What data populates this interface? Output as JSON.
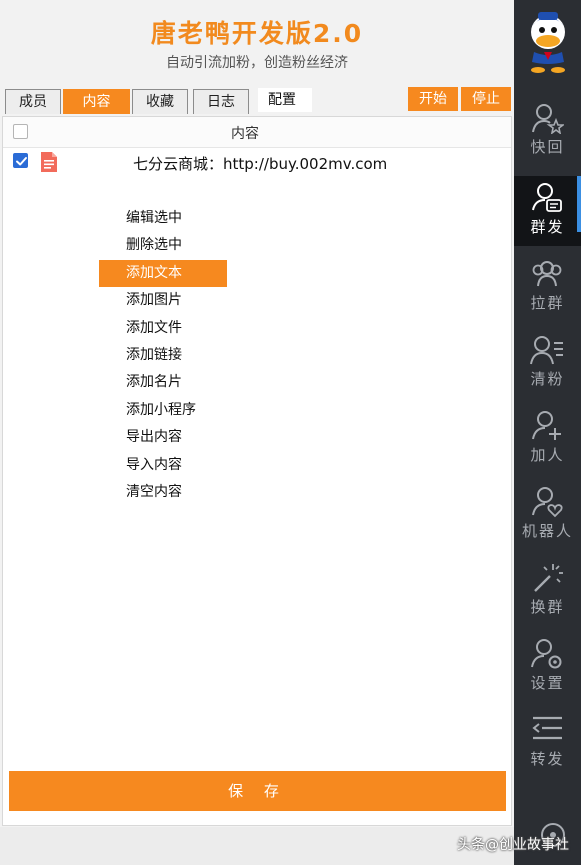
{
  "header": {
    "title": "唐老鸭开发版2.0",
    "subtitle": "自动引流加粉，创造粉丝经济"
  },
  "tabs": [
    {
      "label": "成员",
      "active": false
    },
    {
      "label": "内容",
      "active": true
    },
    {
      "label": "收藏",
      "active": false
    },
    {
      "label": "日志",
      "active": false
    }
  ],
  "config_input": {
    "value": "配置"
  },
  "actions": {
    "start_label": "开始",
    "stop_label": "停止"
  },
  "table": {
    "column_header": "内容",
    "rows": [
      {
        "checked": true,
        "icon": "document-icon",
        "text": "七分云商城：http://buy.002mv.com"
      }
    ]
  },
  "context_menu": {
    "items": [
      {
        "label": "编辑选中",
        "selected": false
      },
      {
        "label": "删除选中",
        "selected": false
      },
      {
        "label": "添加文本",
        "selected": true
      },
      {
        "label": "添加图片",
        "selected": false
      },
      {
        "label": "添加文件",
        "selected": false
      },
      {
        "label": "添加链接",
        "selected": false
      },
      {
        "label": "添加名片",
        "selected": false
      },
      {
        "label": "添加小程序",
        "selected": false
      },
      {
        "label": "导出内容",
        "selected": false
      },
      {
        "label": "导入内容",
        "selected": false
      },
      {
        "label": "清空内容",
        "selected": false
      }
    ]
  },
  "save_button": {
    "label": "保 存"
  },
  "sidebar": {
    "items": [
      {
        "label": "快回",
        "icon": "user-star-icon",
        "active": false
      },
      {
        "label": "群发",
        "icon": "user-message-icon",
        "active": true
      },
      {
        "label": "拉群",
        "icon": "group-icon",
        "active": false
      },
      {
        "label": "清粉",
        "icon": "user-list-icon",
        "active": false
      },
      {
        "label": "加人",
        "icon": "user-add-icon",
        "active": false
      },
      {
        "label": "机器人",
        "icon": "user-heart-icon",
        "active": false
      },
      {
        "label": "换群",
        "icon": "magic-wand-icon",
        "active": false
      },
      {
        "label": "设置",
        "icon": "user-gear-icon",
        "active": false
      },
      {
        "label": "转发",
        "icon": "forward-lines-icon",
        "active": false
      }
    ]
  },
  "watermark": "头条@创业故事社",
  "colors": {
    "accent": "#f6891f",
    "sidebar_bg": "#2b2e33",
    "checkbox": "#2b6cd6"
  }
}
